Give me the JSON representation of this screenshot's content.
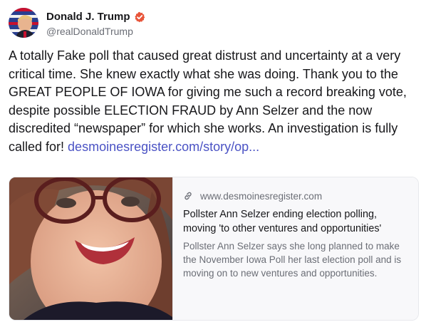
{
  "author": {
    "display_name": "Donald J. Trump",
    "handle": "@realDonaldTrump",
    "verified_color": "#e8553a"
  },
  "post": {
    "text": "A totally Fake poll that caused great distrust and uncertainty at a very critical time. She knew exactly what she was doing. Thank you to the GREAT PEOPLE OF IOWA for giving me such a record breaking vote, despite possible ELECTION FRAUD by Ann Selzer and the now discredited “newspaper” for which she works. An investigation is fully called for! ",
    "link_text": "desmoinesregister.com/story/op..."
  },
  "link_card": {
    "domain": "www.desmoinesregister.com",
    "title": "Pollster Ann Selzer ending election polling, moving 'to other ventures and opportunities'",
    "description": "Pollster Ann Selzer says she long planned to make the November Iowa Poll her last election poll and is moving on to new ventures and opportunities."
  },
  "colors": {
    "text": "#17171a",
    "muted": "#6b6e76",
    "link": "#4a52c4",
    "card_bg": "#f8f8fa",
    "border": "#e7e8ec"
  }
}
